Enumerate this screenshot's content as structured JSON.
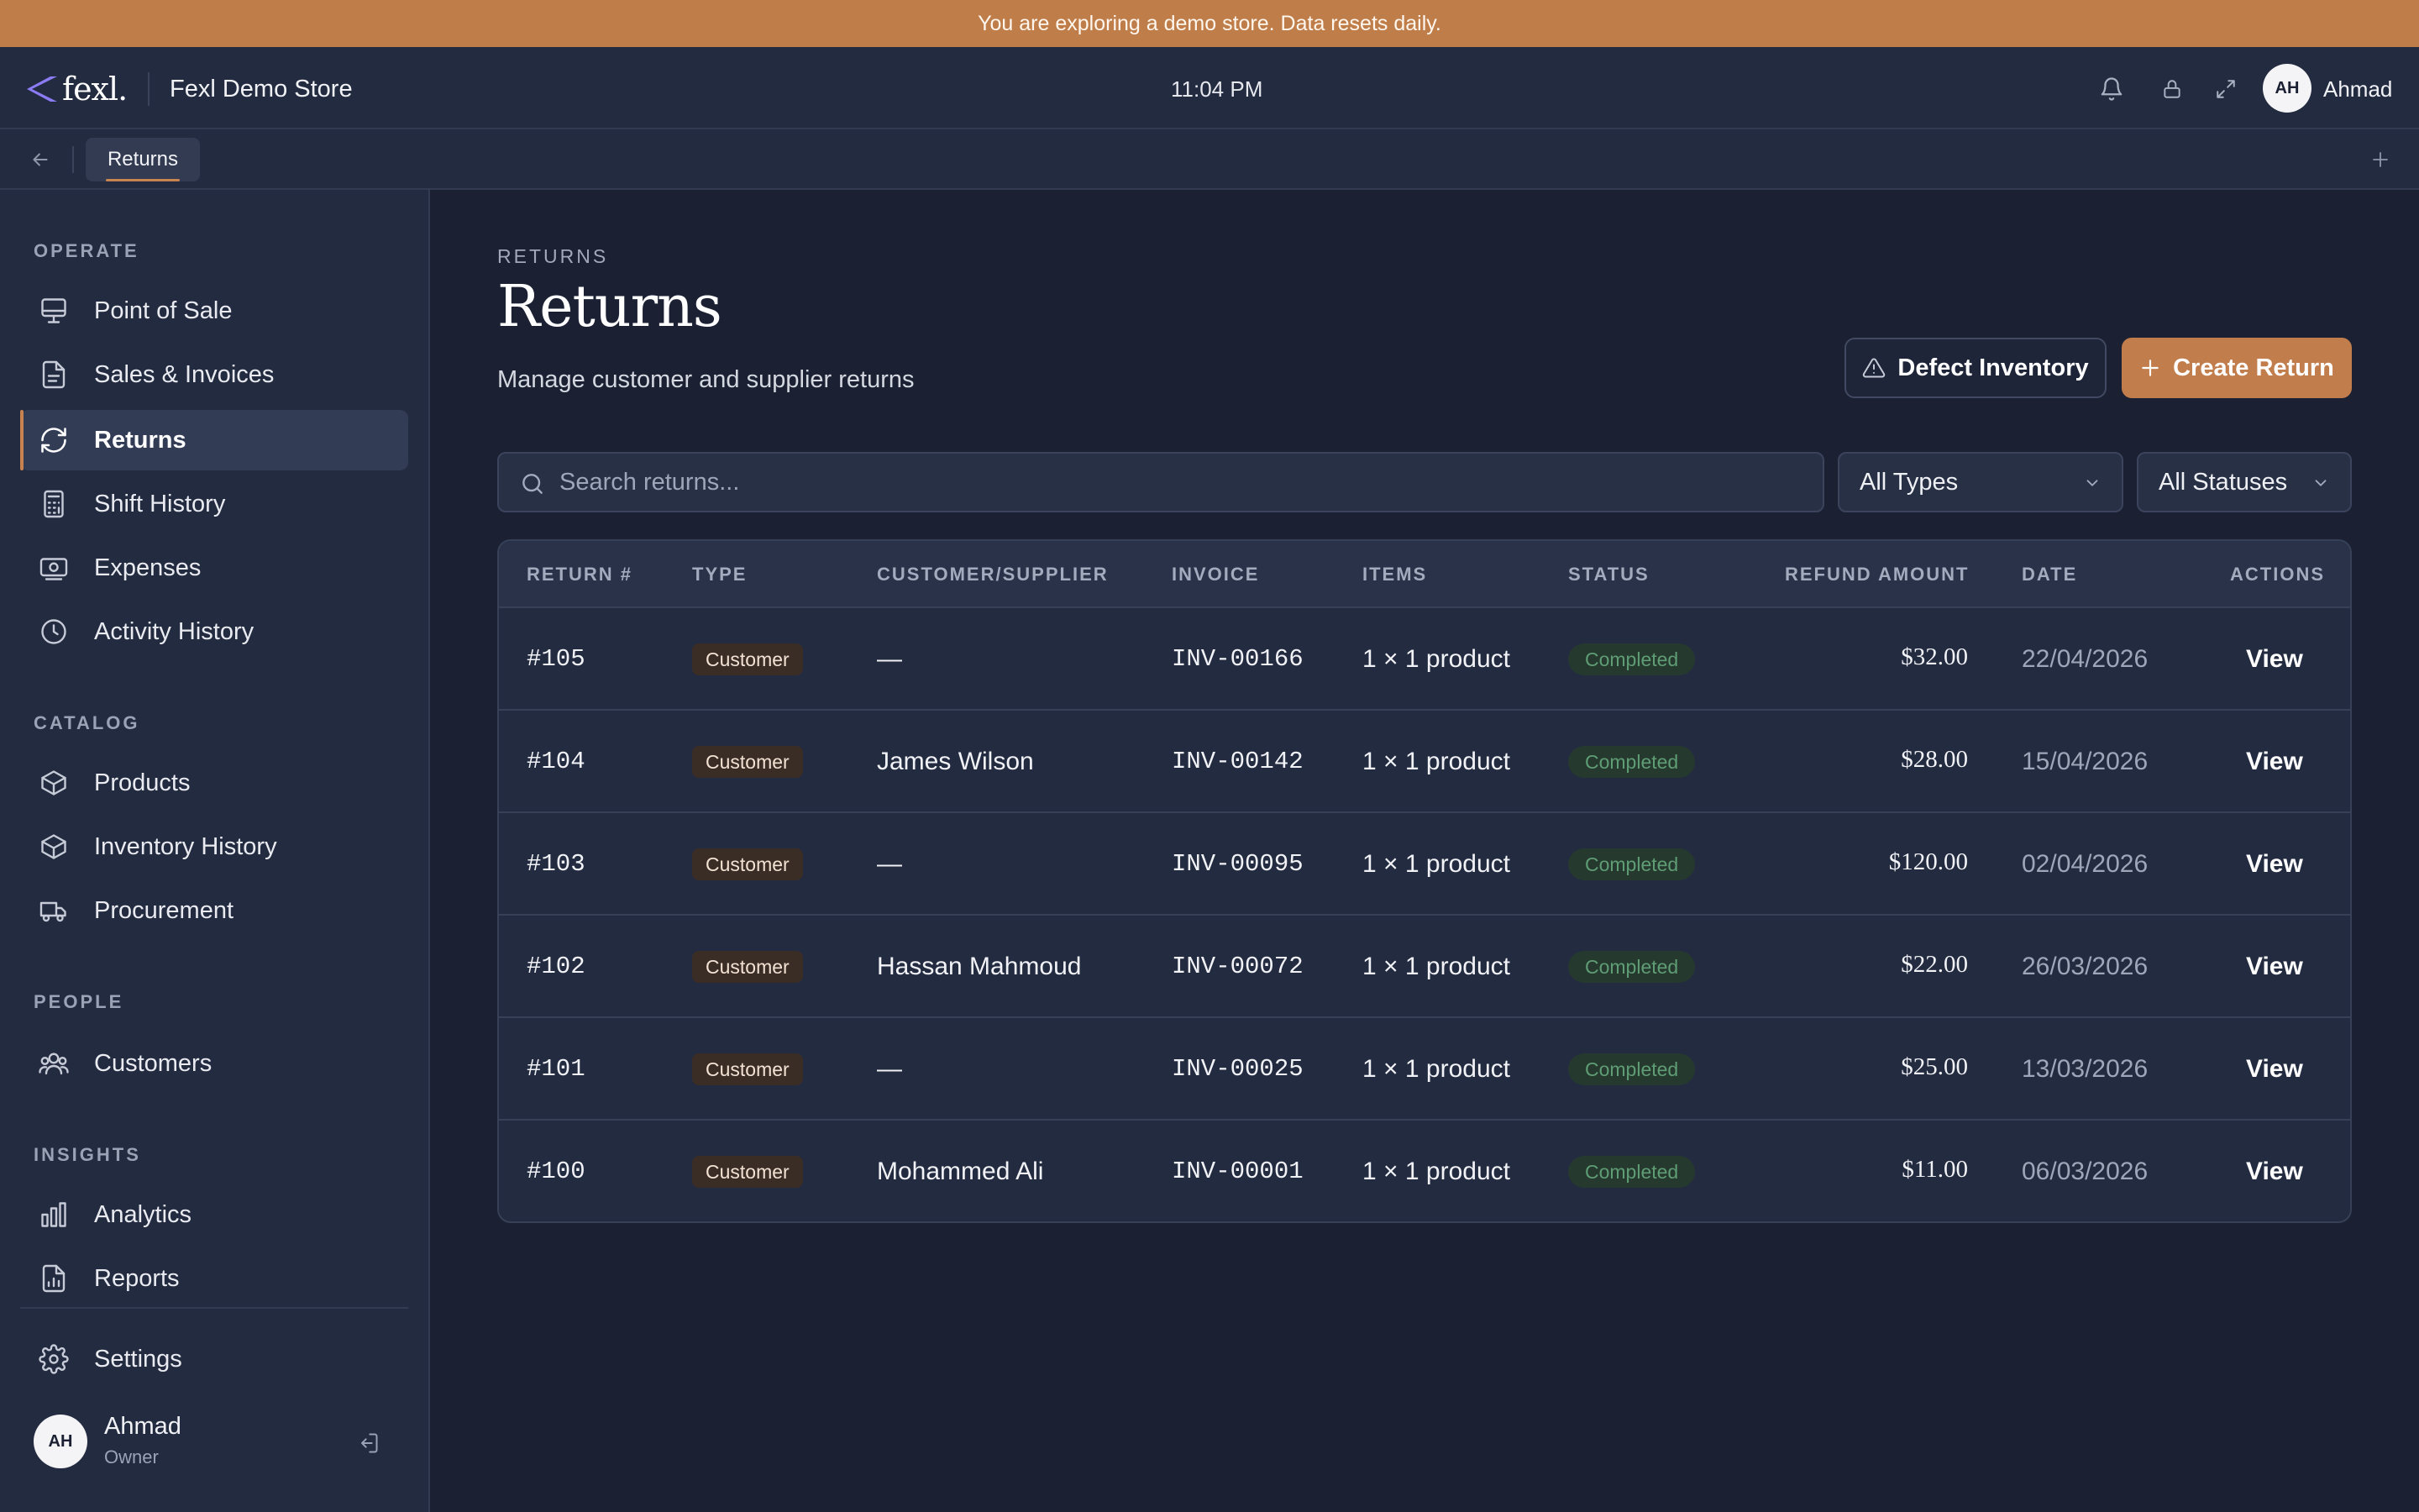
{
  "banner": {
    "text": "You are exploring a demo store. Data resets daily."
  },
  "header": {
    "logo_text": "fexl.",
    "store_name": "Fexl Demo Store",
    "time": "11:04 PM",
    "user_initials": "AH",
    "user_name": "Ahmad",
    "icons": [
      "bell-icon",
      "lock-icon",
      "fullscreen-icon"
    ]
  },
  "tabs": {
    "active_label": "Returns"
  },
  "sidebar": {
    "sections": [
      {
        "label": "OPERATE",
        "items": [
          {
            "label": "Point of Sale",
            "icon": "monitor-icon"
          },
          {
            "label": "Sales & Invoices",
            "icon": "document-icon"
          },
          {
            "label": "Returns",
            "icon": "refresh-icon",
            "active": true
          },
          {
            "label": "Shift History",
            "icon": "calculator-icon"
          },
          {
            "label": "Expenses",
            "icon": "banknote-icon"
          },
          {
            "label": "Activity History",
            "icon": "clock-icon"
          }
        ]
      },
      {
        "label": "CATALOG",
        "items": [
          {
            "label": "Products",
            "icon": "box-icon"
          },
          {
            "label": "Inventory History",
            "icon": "box-icon"
          },
          {
            "label": "Procurement",
            "icon": "truck-icon"
          }
        ]
      },
      {
        "label": "PEOPLE",
        "items": [
          {
            "label": "Customers",
            "icon": "users-icon"
          }
        ]
      },
      {
        "label": "INSIGHTS",
        "items": [
          {
            "label": "Analytics",
            "icon": "bar-chart-icon"
          },
          {
            "label": "Reports",
            "icon": "report-icon"
          }
        ]
      }
    ],
    "settings_label": "Settings",
    "user": {
      "initials": "AH",
      "name": "Ahmad",
      "role": "Owner"
    }
  },
  "page": {
    "eyebrow": "RETURNS",
    "title": "Returns",
    "subtitle": "Manage customer and supplier returns",
    "defect_button": "Defect Inventory",
    "create_button": "Create Return",
    "search_placeholder": "Search returns...",
    "type_filter": "All Types",
    "status_filter": "All Statuses"
  },
  "table": {
    "columns": [
      "RETURN #",
      "TYPE",
      "CUSTOMER/SUPPLIER",
      "INVOICE",
      "ITEMS",
      "STATUS",
      "REFUND AMOUNT",
      "DATE",
      "ACTIONS"
    ],
    "rows": [
      {
        "id": "#105",
        "type": "Customer",
        "party": "—",
        "invoice": "INV-00166",
        "items": "1 × 1 product",
        "status": "Completed",
        "amount": "$32.00",
        "date": "22/04/2026",
        "action": "View"
      },
      {
        "id": "#104",
        "type": "Customer",
        "party": "James Wilson",
        "invoice": "INV-00142",
        "items": "1 × 1 product",
        "status": "Completed",
        "amount": "$28.00",
        "date": "15/04/2026",
        "action": "View"
      },
      {
        "id": "#103",
        "type": "Customer",
        "party": "—",
        "invoice": "INV-00095",
        "items": "1 × 1 product",
        "status": "Completed",
        "amount": "$120.00",
        "date": "02/04/2026",
        "action": "View"
      },
      {
        "id": "#102",
        "type": "Customer",
        "party": "Hassan Mahmoud",
        "invoice": "INV-00072",
        "items": "1 × 1 product",
        "status": "Completed",
        "amount": "$22.00",
        "date": "26/03/2026",
        "action": "View"
      },
      {
        "id": "#101",
        "type": "Customer",
        "party": "—",
        "invoice": "INV-00025",
        "items": "1 × 1 product",
        "status": "Completed",
        "amount": "$25.00",
        "date": "13/03/2026",
        "action": "View"
      },
      {
        "id": "#100",
        "type": "Customer",
        "party": "Mohammed Ali",
        "invoice": "INV-00001",
        "items": "1 × 1 product",
        "status": "Completed",
        "amount": "$11.00",
        "date": "06/03/2026",
        "action": "View"
      }
    ]
  },
  "colors": {
    "accent": "#c27d4c",
    "background": "#1b2133",
    "surface": "#232b40",
    "status_green": "#5f9d74"
  }
}
